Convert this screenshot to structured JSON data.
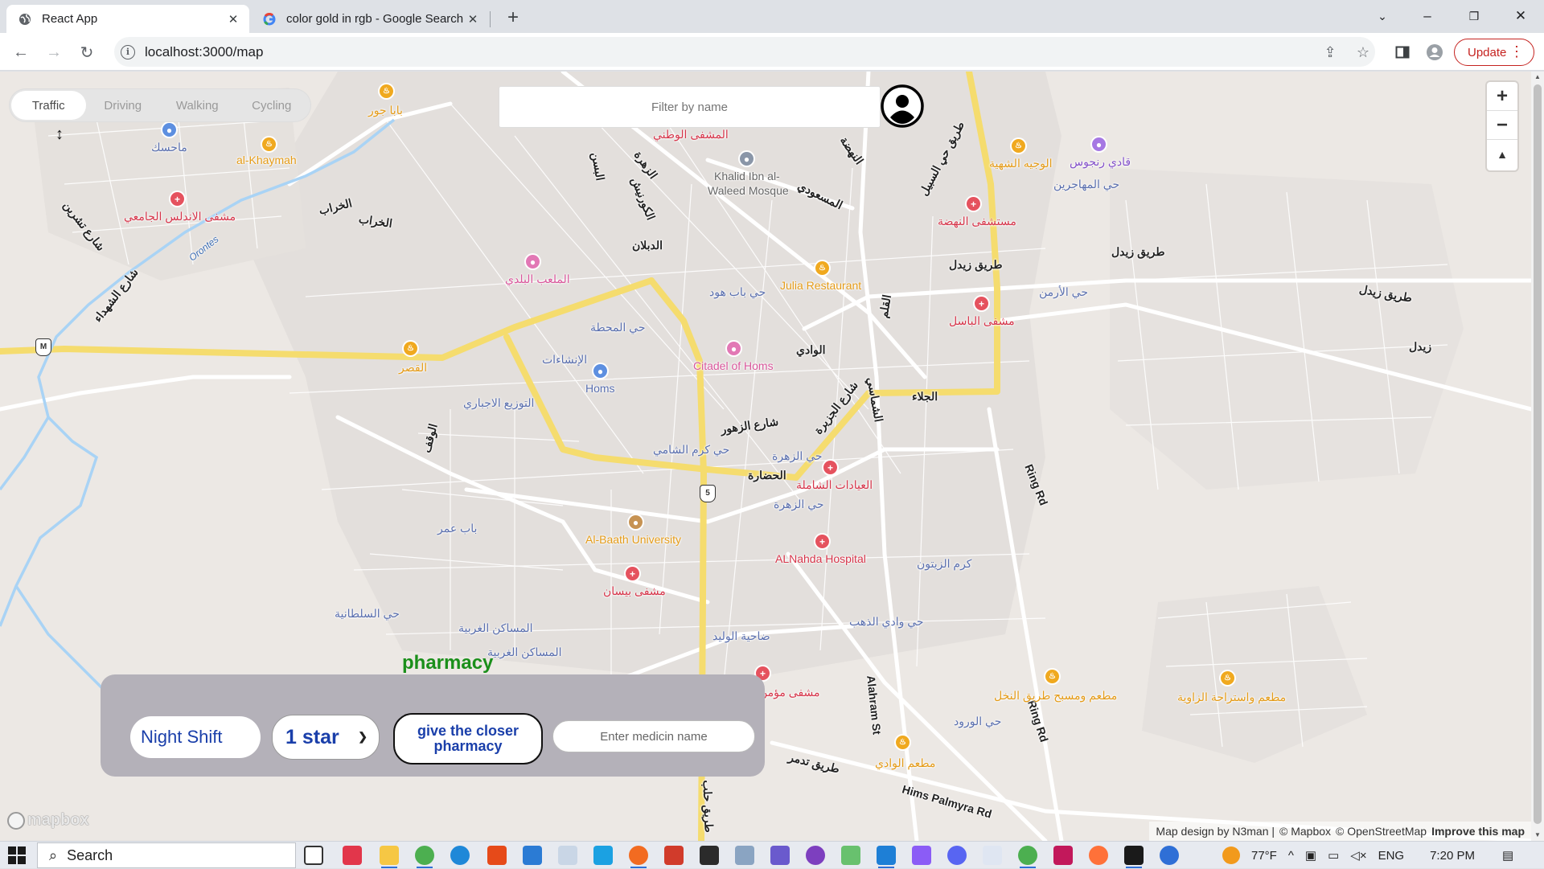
{
  "browser": {
    "tabs": [
      {
        "title": "React App",
        "active": true,
        "icon": "globe-icon"
      },
      {
        "title": "color gold in rgb - Google Search",
        "active": false,
        "icon": "google-icon"
      }
    ],
    "url": "localhost:3000/map",
    "update_label": "Update"
  },
  "map": {
    "modes": [
      "Traffic",
      "Driving",
      "Walking",
      "Cycling"
    ],
    "active_mode": "Traffic",
    "filter_placeholder": "Filter by name",
    "labels": {
      "alkhaymah": "al-Khaymah",
      "mahasek": "ماحسك",
      "babajour": "بابا جور",
      "andalus": "مشفى الاندلس الجامعي",
      "kharab1": "الخراب",
      "kharab2": "الخراب",
      "tishreen": "شارع تشرين",
      "shuhada": "شارع الشهداء",
      "orontes": "Orontes",
      "watani": "المشفى الوطني",
      "khalid1": "Khalid Ibn al-",
      "khalid2": "Waleed Mosque",
      "masoudi": "المسعودي",
      "nahda_r": "النهضة",
      "kournish": "الكورنيش",
      "zahra": "الزهرة",
      "bassel_st": "البسن",
      "diblan": "الدبلان",
      "malaab": "الملعب البلدي",
      "bab_houd": "حي باب هود",
      "mahatta": "حي المحطة",
      "julia": "Julia Restaurant",
      "wajiha": "الوجيه الشهية",
      "rajous": "قادي رنجوس",
      "muhajireen": "حي المهاجرين",
      "nahda_hosp": "مستشفى النهضة",
      "zaidal_rd1": "طريق زيدل",
      "zaidal_rd2": "طريق زيدل",
      "zaidal_rd3": "طريق زيدل",
      "zaidal": "زيدل",
      "arman": "حي الأرمن",
      "basel_hosp": "مشفى الباسل",
      "alqasr": "القصر",
      "inshaat": "الإنشاءات",
      "homs": "Homs",
      "citadel": "Citadel of Homs",
      "wadi": "الوادي",
      "tawzee": "التوزيع الاجباري",
      "waqf": "الوقف",
      "jalaa": "الجلاء",
      "zahour": "شارع الزهور",
      "jazira": "شارع الجزيرة",
      "karm_shami": "حي كرم الشامي",
      "hadara": "الحضارة",
      "zahra2": "حي الزهرة",
      "abadat": "العيادات الشاملة",
      "zahra3": "حي الزهرة",
      "ring1": "Ring Rd",
      "ring2": "Ring Rd",
      "bab_amr": "باب عمر",
      "baath": "Al-Baath University",
      "alnahda": "ALNahda Hospital",
      "karm_zaytoun": "كرم الزيتون",
      "bisan": "مشفى بيسان",
      "sultaniya": "حي السلطانية",
      "masaken1": "المساكن الغربية",
      "masaken2": "المساكن الغربية",
      "waleed": "ضاحية الوليد",
      "wadi_dahab": "حي وادي الذهب",
      "mousa": "مشفى مؤمن",
      "nakhl": "مطعم ومسبح طريق النخل",
      "zawia": "مطعم واستراحة الزاوية",
      "wurud": "حي الورود",
      "alahram": "Alahram St",
      "wadi_rest": "مطعم الوادي",
      "tadmur": "طريق تدمر",
      "palmyra": "Hims Palmyra Rd",
      "shamsin": "الشماسي",
      "tareeq_haleb": "طريق حلب",
      "wadi_sayeh": "طريق حي السبيل",
      "alqalam": "القلم"
    },
    "shields": {
      "m1": "M",
      "m5": "5"
    },
    "attribution": {
      "design": "Map design by N3man |",
      "mapbox": "© Mapbox",
      "osm": "© OpenStreetMap",
      "improve": "Improve this map"
    },
    "logo": "mapbox"
  },
  "panel": {
    "title": "pharmacy",
    "night_shift": "Night Shift",
    "rating": "1 star",
    "closer_button": "give the closer pharmacy",
    "medicine_placeholder": "Enter medicin name"
  },
  "taskbar": {
    "search": "Search",
    "temperature": "77°F",
    "language": "ENG",
    "time": "7:20 PM"
  },
  "colors": {
    "major_road": "#f5dc6e",
    "water": "#a9d3f5",
    "panel": "#b4b1b9",
    "pharmacy_title": "#1a8f1a",
    "button_text": "#1a3faa",
    "update": "#c5221f"
  }
}
